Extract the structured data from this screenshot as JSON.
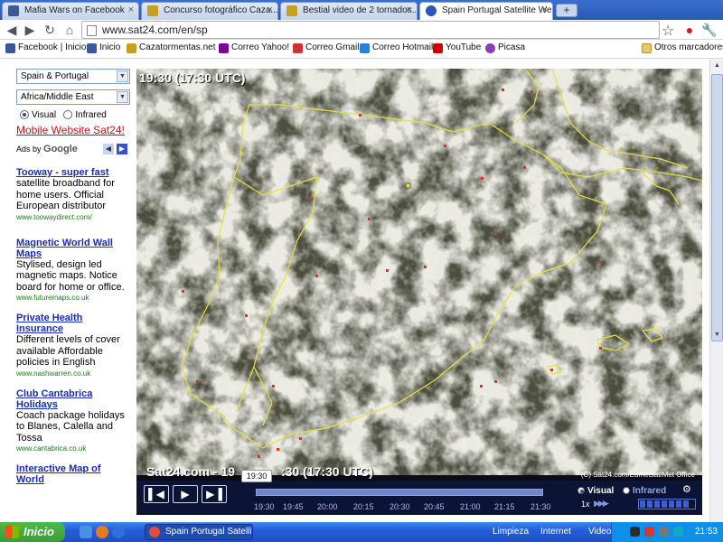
{
  "browser": {
    "tabs": [
      {
        "label": "Mafia Wars on Facebook",
        "icon_color": "#3b5998"
      },
      {
        "label": "Concurso fotográfico Caza...",
        "icon_color": "#c8a020"
      },
      {
        "label": "Bestial video de 2 tornados...",
        "icon_color": "#c8a020"
      },
      {
        "label": "Spain Portugal Satellite We...",
        "icon_color": "#2b56b8"
      }
    ],
    "new_tab": "+",
    "url": "www.sat24.com/en/sp",
    "bookmarks": [
      {
        "label": "Facebook | Inicio",
        "icon_color": "#3b5998"
      },
      {
        "label": "Inicio",
        "icon_color": "#3b5998"
      },
      {
        "label": "Cazatormentas.net",
        "icon_color": "#c8a020"
      },
      {
        "label": "Correo Yahoo!",
        "icon_color": "#7b0099"
      },
      {
        "label": "Correo Gmail",
        "icon_color": "#cc3333"
      },
      {
        "label": "Correo Hotmail",
        "icon_color": "#2a7ed8"
      },
      {
        "label": "YouTube",
        "icon_color": "#cc0000"
      },
      {
        "label": "Picasa",
        "icon_color": "#8a3fb8"
      }
    ],
    "other_bookmarks": "Otros marcadores"
  },
  "sidebar": {
    "region_select": "Spain & Portugal",
    "area_select": "Africa/Middle East",
    "visual_label": "Visual",
    "infrared_label": "Infrared",
    "mobile_link": "Mobile Website Sat24!",
    "ads_by": "Ads by",
    "google": "Google",
    "ads": [
      {
        "title": "Tooway - super fast",
        "desc": "satellite broadband for home users. Official European distributor",
        "url": "www.toowaydirect.com/"
      },
      {
        "title": "Magnetic World Wall Maps",
        "desc": "Stylised, design led magnetic maps. Notice board for home or office.",
        "url": "www.futuremaps.co.uk"
      },
      {
        "title": "Private Health Insurance",
        "desc": "Different levels of cover available Affordable policies in English",
        "url": "www.nashwarren.co.uk"
      },
      {
        "title": "Club Cantabrica Holidays",
        "desc": "Coach package holidays to Blanes, Calella and Tossa",
        "url": "www.cantabrica.co.uk"
      },
      {
        "title": "Interactive Map of World",
        "desc": "",
        "url": ""
      }
    ]
  },
  "viewer": {
    "timestamp": "19:30 (17:30 UTC)",
    "brand": "Sat24.com - 19",
    "brand_time": ":30 (17:30 UTC)",
    "credit": "(C) Sat24.com/Eumetsat/Met Office",
    "tooltip": "19:30",
    "times": [
      "19:30",
      "19:45",
      "20:00",
      "20:15",
      "20:30",
      "20:45",
      "21:00",
      "21:15",
      "21:30"
    ],
    "visual": "Visual",
    "infrared": "Infrared",
    "speed": "1x"
  },
  "taskbar": {
    "start": "Inicio",
    "task": "Spain Portugal Satellit...",
    "limpieza": "Limpieza",
    "internet": "Internet",
    "video": "Video",
    "clock": "21:53"
  }
}
